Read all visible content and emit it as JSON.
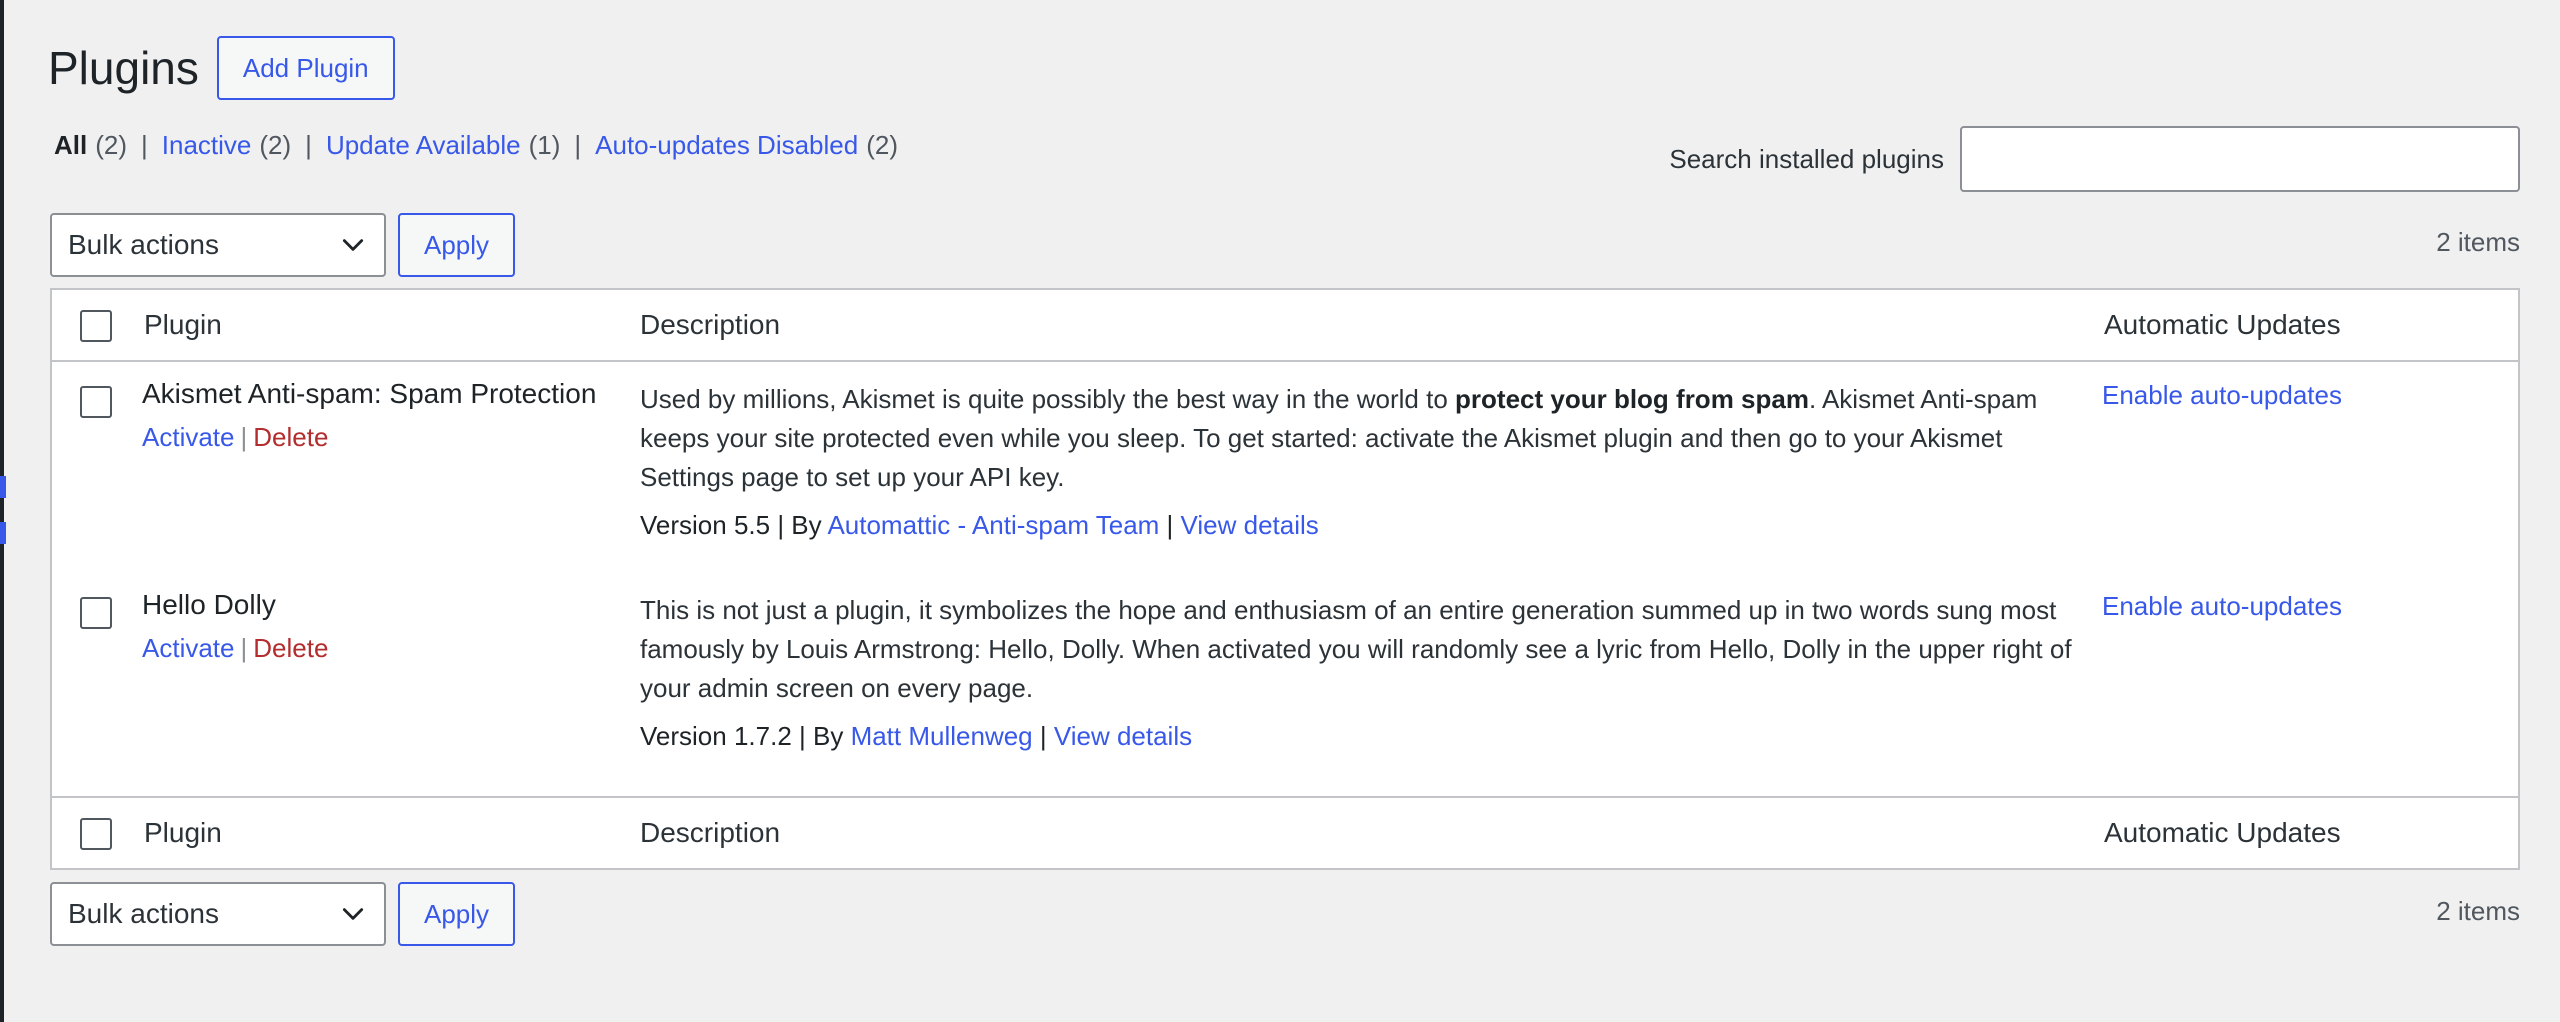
{
  "header": {
    "title": "Plugins",
    "add_button": "Add Plugin"
  },
  "filters": [
    {
      "label": "All",
      "count": "(2)",
      "current": true
    },
    {
      "label": "Inactive",
      "count": "(2)",
      "current": false
    },
    {
      "label": "Update Available",
      "count": "(1)",
      "current": false
    },
    {
      "label": "Auto-updates Disabled",
      "count": "(2)",
      "current": false
    }
  ],
  "search": {
    "label": "Search installed plugins",
    "value": "",
    "placeholder": ""
  },
  "tablenav": {
    "bulk_actions": "Bulk actions",
    "apply": "Apply",
    "items_count": "2 items"
  },
  "columns": {
    "plugin": "Plugin",
    "description": "Description",
    "auto_updates": "Automatic Updates"
  },
  "plugins": [
    {
      "name": "Akismet Anti-spam: Spam Protection",
      "activate": "Activate",
      "delete": "Delete",
      "desc_before": "Used by millions, Akismet is quite possibly the best way in the world to ",
      "desc_bold": "protect your blog from spam",
      "desc_after": ". Akismet Anti-spam keeps your site protected even while you sleep. To get started: activate the Akismet plugin and then go to your Akismet Settings page to set up your API key.",
      "version": "Version 5.5",
      "by": "By",
      "author": "Automattic - Anti-spam Team",
      "view_details": "View details",
      "auto_update": "Enable auto-updates"
    },
    {
      "name": "Hello Dolly",
      "activate": "Activate",
      "delete": "Delete",
      "desc_before": "This is not just a plugin, it symbolizes the hope and enthusiasm of an entire generation summed up in two words sung most famously by Louis Armstrong: Hello, Dolly. When activated you will randomly see a lyric from Hello, Dolly in the upper right of your admin screen on every page.",
      "desc_bold": "",
      "desc_after": "",
      "version": "Version 1.7.2",
      "by": "By",
      "author": "Matt Mullenweg",
      "view_details": "View details",
      "auto_update": "Enable auto-updates"
    }
  ],
  "icons": {
    "bulk_dropdown": "chevron-down-icon"
  },
  "colors": {
    "accent": "#3858e9",
    "delete": "#b32d2e",
    "background": "#f0f0f1"
  }
}
